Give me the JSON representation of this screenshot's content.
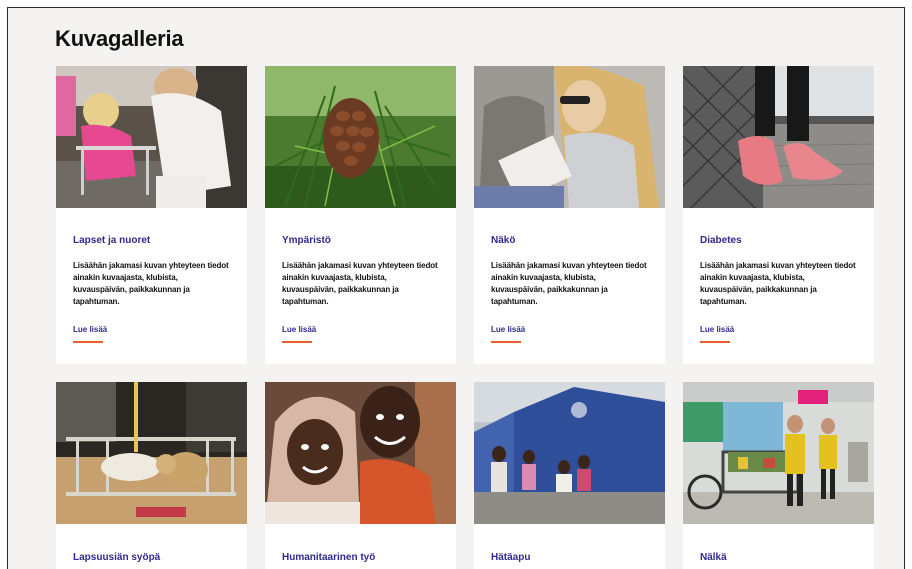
{
  "page": {
    "title": "Kuvagalleria"
  },
  "cards": [
    {
      "title": "Lapset ja nuoret",
      "text": "Lisäähän jakamasi kuvan yhteyteen tiedot ainakin kuvaajasta, klubista, kuvauspäivän, paikkakunnan ja tapahtuman.",
      "link": "Lue lisää"
    },
    {
      "title": "Ympäristö",
      "text": "Lisäähän jakamasi kuvan yhteyteen tiedot ainakin kuvaajasta, klubista, kuvauspäivän, paikkakunnan ja tapahtuman.",
      "link": "Lue lisää"
    },
    {
      "title": "Näkö",
      "text": "Lisäähän jakamasi kuvan yhteyteen tiedot ainakin kuvaajasta, klubista, kuvauspäivän, paikkakunnan ja tapahtuman.",
      "link": "Lue lisää"
    },
    {
      "title": "Diabetes",
      "text": "Lisäähän jakamasi kuvan yhteyteen tiedot ainakin kuvaajasta, klubista, kuvauspäivän, paikkakunnan ja tapahtuman.",
      "link": "Lue lisää"
    },
    {
      "title": "Lapsuusiän syöpä"
    },
    {
      "title": "Humanitaarinen työ"
    },
    {
      "title": "Hätäapu"
    },
    {
      "title": "Nälkä"
    }
  ],
  "colors": {
    "accent_text": "#2f2a8e",
    "link_underline": "#e8602c",
    "page_background": "#f4f3f1",
    "card_background": "#ffffff"
  }
}
